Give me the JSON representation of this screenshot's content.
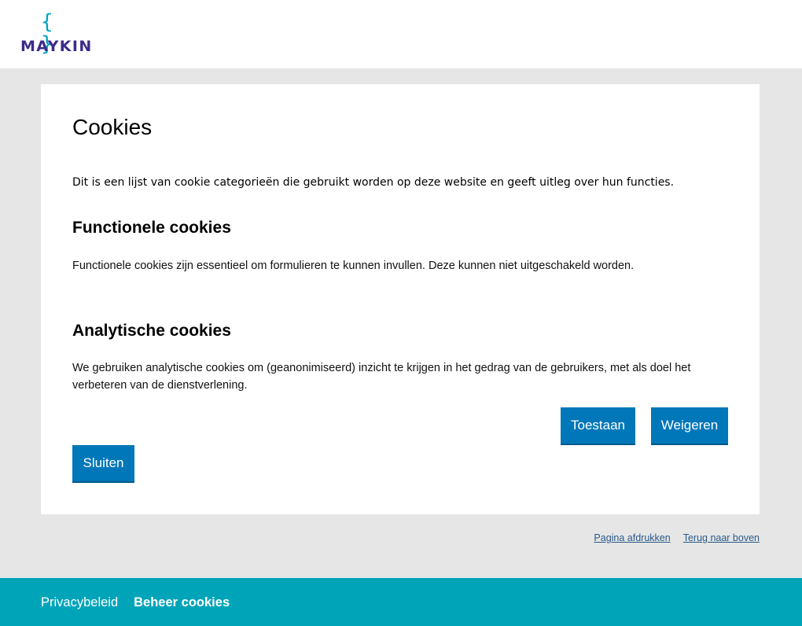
{
  "header": {
    "logo_braces": "{ }",
    "logo_text": "MAYKIN"
  },
  "main": {
    "title": "Cookies",
    "intro": "Dit is een lijst van cookie categorieën die gebruikt worden op deze website en geeft uitleg over hun functies.",
    "sections": [
      {
        "title": "Functionele cookies",
        "text": "Functionele cookies zijn essentieel om formulieren te kunnen invullen. Deze kunnen niet uitgeschakeld worden."
      },
      {
        "title": "Analytische cookies",
        "text": "We gebruiken analytische cookies om (geanonimiseerd) inzicht te krijgen in het gedrag van de gebruikers, met als doel het verbeteren van de dienstverlening.",
        "allow_label": "Toestaan",
        "deny_label": "Weigeren"
      }
    ],
    "close_label": "Sluiten"
  },
  "utility_links": {
    "print": "Pagina afdrukken",
    "back_to_top": "Terug naar boven"
  },
  "footer": {
    "privacy": "Privacybeleid",
    "manage_cookies": "Beheer cookies"
  },
  "colors": {
    "button": "#0077b8",
    "footer": "#00a4b9",
    "logo_text": "#3d2a8a",
    "logo_braces": "#00a5c4"
  }
}
